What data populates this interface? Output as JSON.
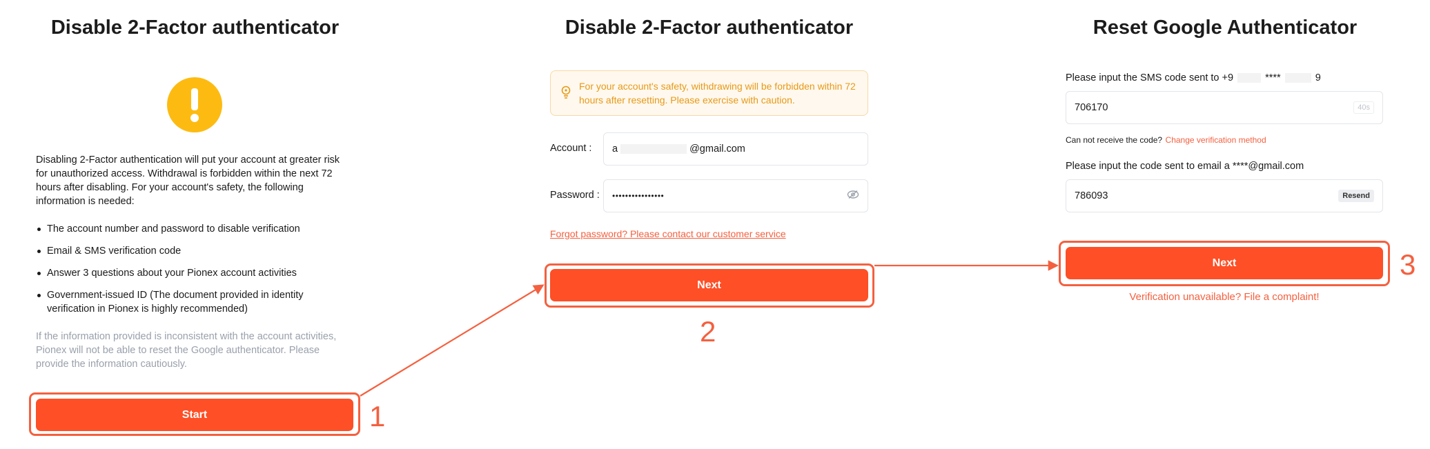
{
  "panel1": {
    "title": "Disable 2-Factor authenticator",
    "warning_icon": "exclamation-circle-icon",
    "description": "Disabling 2-Factor authentication will put your account at greater risk for unauthorized access. Withdrawal is forbidden within the next 72 hours after disabling. For your account's safety, the following information is needed:",
    "requirements": [
      "The account number and password to disable verification",
      "Email & SMS verification code",
      "Answer 3 questions about your Pionex account activities",
      "Government-issued ID (The document provided in identity verification in Pionex is highly recommended)"
    ],
    "note": "If the information provided is inconsistent with the account activities, Pionex will not be able to reset the Google authenticator. Please provide the information cautiously.",
    "start_label": "Start",
    "step_number": "1"
  },
  "panel2": {
    "title": "Disable 2-Factor authenticator",
    "notice": "For your account's safety, withdrawing will be forbidden within 72 hours after resetting. Please exercise with caution.",
    "account_label": "Account :",
    "account_prefix": "a",
    "account_suffix": "@gmail.com",
    "password_label": "Password :",
    "password_value": "••••••••••••••••",
    "forgot_link": "Forgot password? Please contact our customer service",
    "next_label": "Next",
    "step_number": "2"
  },
  "panel3": {
    "title": "Reset Google Authenticator",
    "sms_label_prefix": "Please input the SMS code sent to +9",
    "sms_label_mid": "****",
    "sms_label_suffix": "9",
    "sms_code": "706170",
    "sms_timer": "40s",
    "cannot_receive": "Can not receive the code?",
    "change_method": "Change verification method",
    "email_label_prefix": "Please input the code sent to email a",
    "email_label_suffix": "****@gmail.com",
    "email_code": "786093",
    "resend_label": "Resend",
    "next_label": "Next",
    "complaint": "Verification unavailable? File a complaint!",
    "step_number": "3"
  },
  "colors": {
    "accent": "#fe4f26",
    "annotation": "#f4603f",
    "warning_yellow": "#fdbb12",
    "notice_text": "#e69a17"
  }
}
